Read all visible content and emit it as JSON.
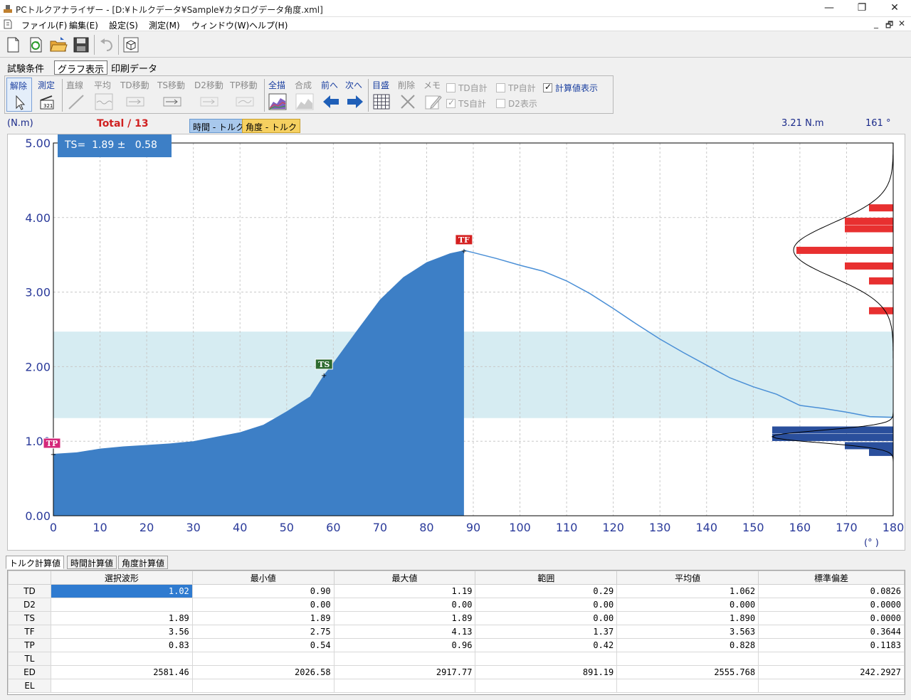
{
  "window": {
    "title": "PCトルクアナライザー - [D:¥トルクデータ¥Sample¥カタログデータ角度.xml]",
    "minimize": "—",
    "restore": "❐",
    "close": "✕"
  },
  "menu": {
    "items": [
      "ファイル(F)",
      "編集(E)",
      "設定(S)",
      "測定(M)",
      "ウィンドウ(W)",
      "ヘルプ(H)"
    ],
    "mdi_controls": [
      "_",
      "🗗",
      "✕"
    ]
  },
  "toolbar": {
    "icons": [
      "new-file-icon",
      "refresh-icon",
      "open-folder-icon",
      "save-icon",
      "undo-icon",
      "cube-icon"
    ]
  },
  "page_tabs": [
    "試験条件",
    "グラフ表示",
    "印刷データ"
  ],
  "graph_toolbar": {
    "groups": [
      {
        "label": "解除",
        "icon": "cursor-icon",
        "enabled": true
      },
      {
        "label": "測定",
        "icon": "measure-icon",
        "enabled": true
      },
      {
        "label": "直線",
        "icon": "line-icon",
        "enabled": false
      },
      {
        "label": "平均",
        "icon": "average-icon",
        "enabled": false
      },
      {
        "label": "TD移動",
        "icon": "td-move-icon",
        "enabled": false
      },
      {
        "label": "TS移動",
        "icon": "ts-move-icon",
        "enabled": false
      },
      {
        "label": "D2移動",
        "icon": "d2-move-icon",
        "enabled": false
      },
      {
        "label": "TP移動",
        "icon": "tp-move-icon",
        "enabled": false
      },
      {
        "label": "全描",
        "icon": "draw-all-icon",
        "enabled": true
      },
      {
        "label": "合成",
        "icon": "composite-icon",
        "enabled": false
      },
      {
        "label": "前へ",
        "icon": "arrow-left-icon",
        "enabled": true
      },
      {
        "label": "次へ",
        "icon": "arrow-right-icon",
        "enabled": true
      },
      {
        "label": "目盛",
        "icon": "grid-icon",
        "enabled": true
      },
      {
        "label": "削除",
        "icon": "delete-x-icon",
        "enabled": false
      },
      {
        "label": "メモ",
        "icon": "memo-pen-icon",
        "enabled": false
      }
    ],
    "checkboxes": [
      {
        "label": "TD自計",
        "checked": false,
        "enabled": false
      },
      {
        "label": "TS自計",
        "checked": true,
        "enabled": false
      },
      {
        "label": "TP自計",
        "checked": false,
        "enabled": false
      },
      {
        "label": "D2表示",
        "checked": false,
        "enabled": false
      },
      {
        "label": "計算値表示",
        "checked": true,
        "enabled": true
      }
    ],
    "check_mark": "✓"
  },
  "info": {
    "unit": "(N.m)",
    "total": "Total / 13",
    "mode_time": "時間 - トルク",
    "mode_angle": "角度 - トルク",
    "readout_torque": "3.21 N.m",
    "readout_angle": "161 °",
    "ts_summary": "TS=  1.89 ±   0.58",
    "angle_unit": "(° )"
  },
  "chart_data": {
    "type": "area",
    "x_unit": "°",
    "y_unit": "N.m",
    "xlim": [
      0,
      180
    ],
    "ylim": [
      0,
      5
    ],
    "x_ticks": [
      "0",
      "10",
      "20",
      "30",
      "40",
      "50",
      "60",
      "70",
      "80",
      "90",
      "100",
      "110",
      "120",
      "130",
      "140",
      "150",
      "160",
      "170",
      "180"
    ],
    "y_ticks": [
      "0.00",
      "1.00",
      "2.00",
      "3.00",
      "4.00",
      "5.00"
    ],
    "grid": true,
    "band": {
      "y_from": 1.31,
      "y_to": 2.47,
      "color": "#d6ecf2"
    },
    "fill_color": "#3d7fc6",
    "line_color": "#4a8fd6",
    "filled_until_x": 88,
    "points": [
      [
        0,
        0.83
      ],
      [
        5,
        0.85
      ],
      [
        10,
        0.9
      ],
      [
        15,
        0.93
      ],
      [
        20,
        0.95
      ],
      [
        25,
        0.97
      ],
      [
        30,
        1.0
      ],
      [
        35,
        1.06
      ],
      [
        40,
        1.12
      ],
      [
        45,
        1.22
      ],
      [
        50,
        1.4
      ],
      [
        55,
        1.6
      ],
      [
        58,
        1.89
      ],
      [
        60,
        2.05
      ],
      [
        65,
        2.48
      ],
      [
        70,
        2.9
      ],
      [
        75,
        3.2
      ],
      [
        80,
        3.4
      ],
      [
        85,
        3.52
      ],
      [
        88,
        3.56
      ],
      [
        90,
        3.53
      ],
      [
        95,
        3.45
      ],
      [
        100,
        3.36
      ],
      [
        105,
        3.28
      ],
      [
        110,
        3.15
      ],
      [
        115,
        2.98
      ],
      [
        120,
        2.78
      ],
      [
        125,
        2.57
      ],
      [
        130,
        2.37
      ],
      [
        135,
        2.19
      ],
      [
        140,
        2.02
      ],
      [
        145,
        1.85
      ],
      [
        150,
        1.73
      ],
      [
        155,
        1.63
      ],
      [
        160,
        1.48
      ],
      [
        165,
        1.44
      ],
      [
        170,
        1.39
      ],
      [
        175,
        1.33
      ],
      [
        180,
        1.32
      ]
    ],
    "markers": [
      {
        "label": "TP",
        "x": 0,
        "y": 0.83,
        "color": "#d4287a"
      },
      {
        "label": "TS",
        "x": 58,
        "y": 1.89,
        "color": "#2e6b30"
      },
      {
        "label": "TF",
        "x": 88,
        "y": 3.56,
        "color": "#d42020"
      }
    ],
    "histogram_upper": {
      "color": "#e83030",
      "bins": [
        {
          "y": 4.13,
          "count": 1
        },
        {
          "y": 3.95,
          "count": 2
        },
        {
          "y": 3.85,
          "count": 2
        },
        {
          "y": 3.56,
          "count": 4
        },
        {
          "y": 3.35,
          "count": 2
        },
        {
          "y": 3.15,
          "count": 1
        },
        {
          "y": 2.75,
          "count": 1
        }
      ]
    },
    "histogram_lower": {
      "color": "#2a4f9c",
      "bins": [
        {
          "y": 1.15,
          "count": 5
        },
        {
          "y": 1.05,
          "count": 5
        },
        {
          "y": 0.94,
          "count": 2
        },
        {
          "y": 0.85,
          "count": 1
        }
      ]
    }
  },
  "bottom_tabs": [
    "トルク計算値",
    "時間計算値",
    "角度計算値"
  ],
  "table": {
    "headers": [
      "",
      "選択波形",
      "最小値",
      "最大値",
      "範囲",
      "平均値",
      "標準偏差"
    ],
    "rows": [
      {
        "name": "TD",
        "cells": [
          "1.02",
          "0.90",
          "1.19",
          "0.29",
          "1.062",
          "0.0826"
        ]
      },
      {
        "name": "D2",
        "cells": [
          "",
          "0.00",
          "0.00",
          "0.00",
          "0.000",
          "0.0000"
        ]
      },
      {
        "name": "TS",
        "cells": [
          "1.89",
          "1.89",
          "1.89",
          "0.00",
          "1.890",
          "0.0000"
        ]
      },
      {
        "name": "TF",
        "cells": [
          "3.56",
          "2.75",
          "4.13",
          "1.37",
          "3.563",
          "0.3644"
        ]
      },
      {
        "name": "TP",
        "cells": [
          "0.83",
          "0.54",
          "0.96",
          "0.42",
          "0.828",
          "0.1183"
        ]
      },
      {
        "name": "TL",
        "cells": [
          "",
          "",
          "",
          "",
          "",
          ""
        ]
      },
      {
        "name": "ED",
        "cells": [
          "2581.46",
          "2026.58",
          "2917.77",
          "891.19",
          "2555.768",
          "242.2927"
        ]
      },
      {
        "name": "EL",
        "cells": [
          "",
          "",
          "",
          "",
          "",
          ""
        ]
      }
    ]
  }
}
